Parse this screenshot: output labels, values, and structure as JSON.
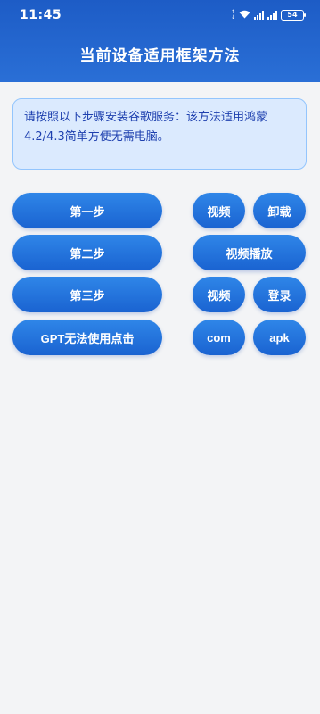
{
  "status_bar": {
    "time": "11:45",
    "battery": "54"
  },
  "header": {
    "title": "当前设备适用框架方法"
  },
  "notice": {
    "text": "请按照以下步骤安装谷歌服务：该方法适用鸿蒙4.2/4.3简单方便无需电脑。"
  },
  "buttons": {
    "step1": "第一步",
    "video1": "视频",
    "uninstall": "卸载",
    "step2": "第二步",
    "video_play": "视频播放",
    "step3": "第三步",
    "video3": "视频",
    "login": "登录",
    "gpt": "GPT无法使用点击",
    "com": "com",
    "apk": "apk"
  },
  "colors": {
    "header_bg": "#1d5cc6",
    "button_bg": "#1a63d1",
    "notice_bg": "#dbeafe",
    "notice_border": "#93c5fd",
    "page_bg": "#f3f4f6"
  }
}
